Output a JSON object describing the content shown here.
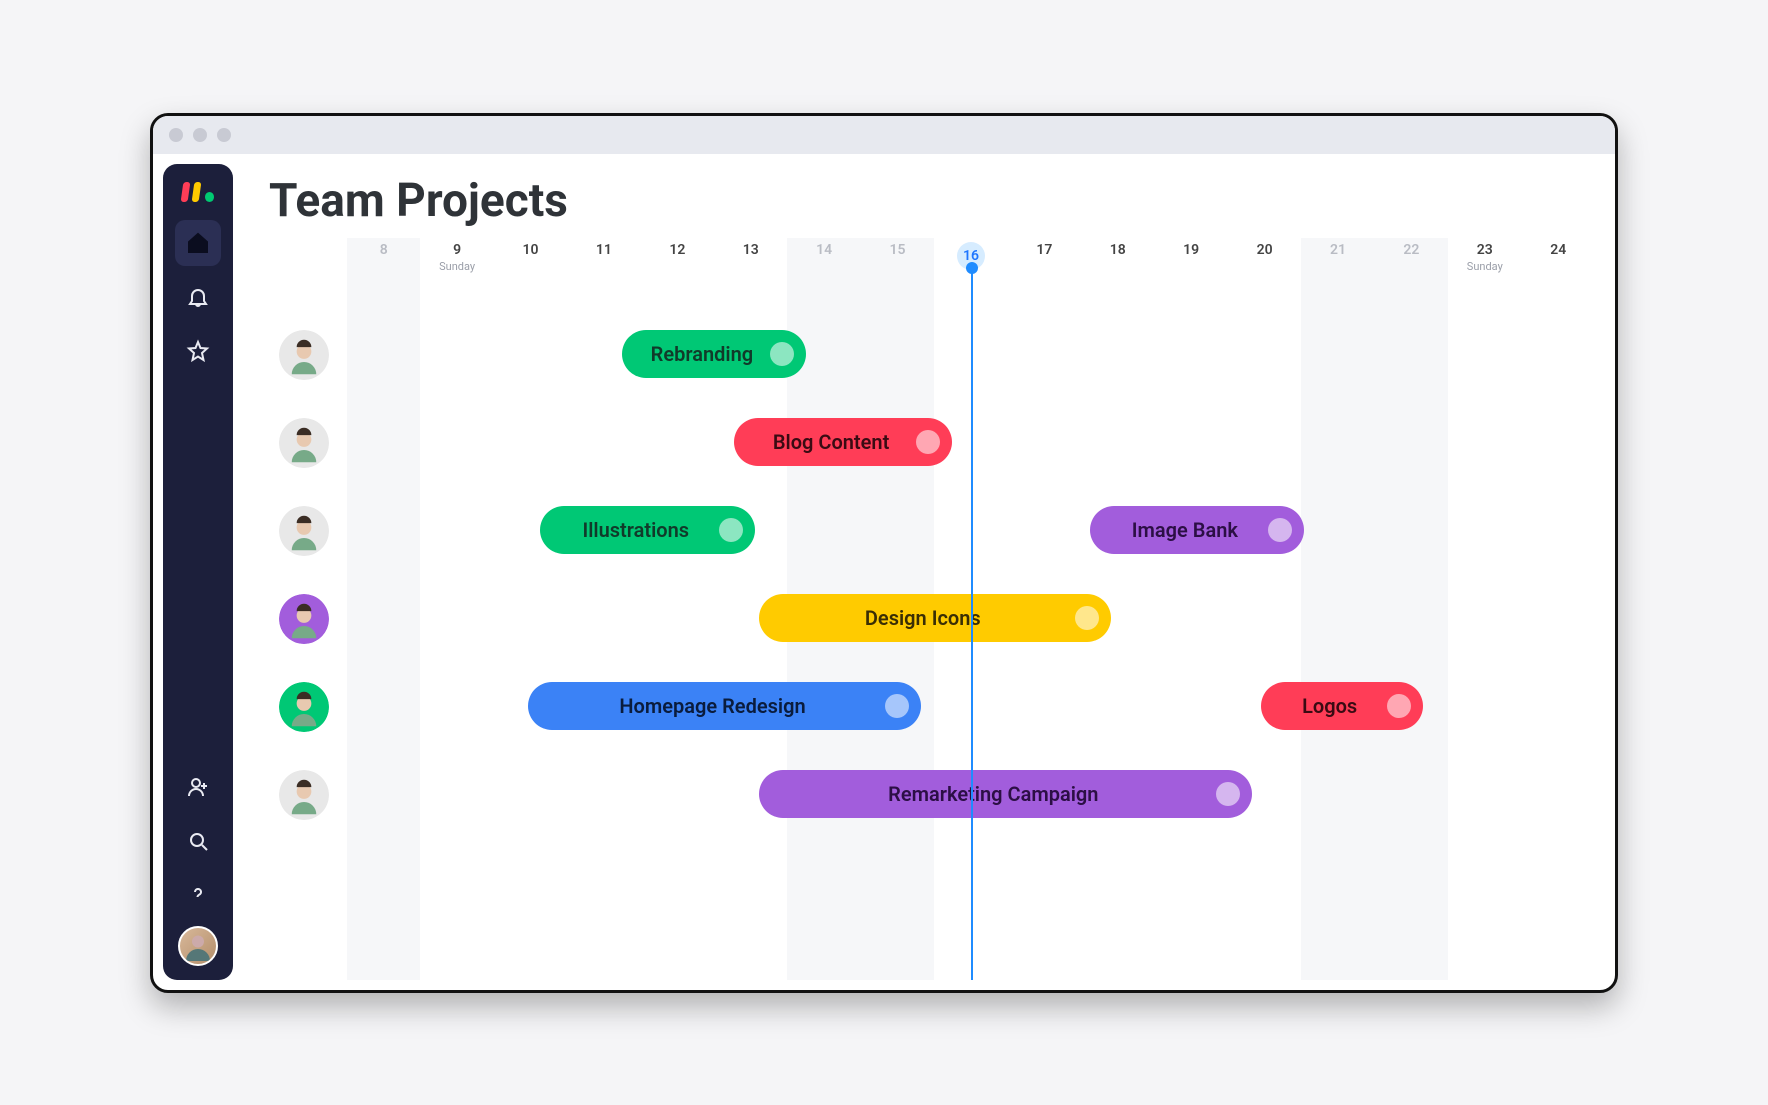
{
  "page": {
    "title": "Team Projects"
  },
  "timeline": {
    "days": [
      {
        "num": "8",
        "muted": true,
        "sub": ""
      },
      {
        "num": "9",
        "muted": false,
        "sub": "Sunday"
      },
      {
        "num": "10",
        "muted": false,
        "sub": ""
      },
      {
        "num": "11",
        "muted": false,
        "sub": ""
      },
      {
        "num": "12",
        "muted": false,
        "sub": ""
      },
      {
        "num": "13",
        "muted": false,
        "sub": ""
      },
      {
        "num": "14",
        "muted": true,
        "sub": ""
      },
      {
        "num": "15",
        "muted": true,
        "sub": ""
      },
      {
        "num": "16",
        "muted": false,
        "sub": "",
        "today": true
      },
      {
        "num": "17",
        "muted": false,
        "sub": ""
      },
      {
        "num": "18",
        "muted": false,
        "sub": ""
      },
      {
        "num": "19",
        "muted": false,
        "sub": ""
      },
      {
        "num": "20",
        "muted": false,
        "sub": ""
      },
      {
        "num": "21",
        "muted": true,
        "sub": ""
      },
      {
        "num": "22",
        "muted": true,
        "sub": ""
      },
      {
        "num": "23",
        "muted": false,
        "sub": "Sunday"
      },
      {
        "num": "24",
        "muted": false,
        "sub": ""
      }
    ],
    "today_index": 8
  },
  "rows": [
    {
      "avatar_bg": "#e8e8e8",
      "tasks": [
        {
          "label": "Rebranding",
          "color": "green",
          "start_pct": 22.0,
          "width_pct": 14.8
        }
      ]
    },
    {
      "avatar_bg": "#e8e8e8",
      "tasks": [
        {
          "label": "Blog Content",
          "color": "red",
          "start_pct": 31.0,
          "width_pct": 17.5
        }
      ]
    },
    {
      "avatar_bg": "#e8e8e8",
      "tasks": [
        {
          "label": "Illustrations",
          "color": "green",
          "start_pct": 15.5,
          "width_pct": 17.2
        },
        {
          "label": "Image Bank",
          "color": "purple",
          "start_pct": 59.5,
          "width_pct": 17.2
        }
      ]
    },
    {
      "avatar_bg": "#a25ddc",
      "tasks": [
        {
          "label": "Design Icons",
          "color": "yellow",
          "start_pct": 33.0,
          "width_pct": 28.2
        }
      ]
    },
    {
      "avatar_bg": "#00c875",
      "tasks": [
        {
          "label": "Homepage Redesign",
          "color": "blue",
          "start_pct": 14.5,
          "width_pct": 31.5
        },
        {
          "label": "Logos",
          "color": "red",
          "start_pct": 73.2,
          "width_pct": 13.0
        }
      ]
    },
    {
      "avatar_bg": "#e8e8e8",
      "tasks": [
        {
          "label": "Remarketing Campaign",
          "color": "purple",
          "start_pct": 33.0,
          "width_pct": 39.5
        }
      ]
    }
  ],
  "sidebar": {
    "items": [
      "home",
      "notifications",
      "favorites"
    ],
    "bottom_items": [
      "add-user",
      "search",
      "help"
    ]
  }
}
